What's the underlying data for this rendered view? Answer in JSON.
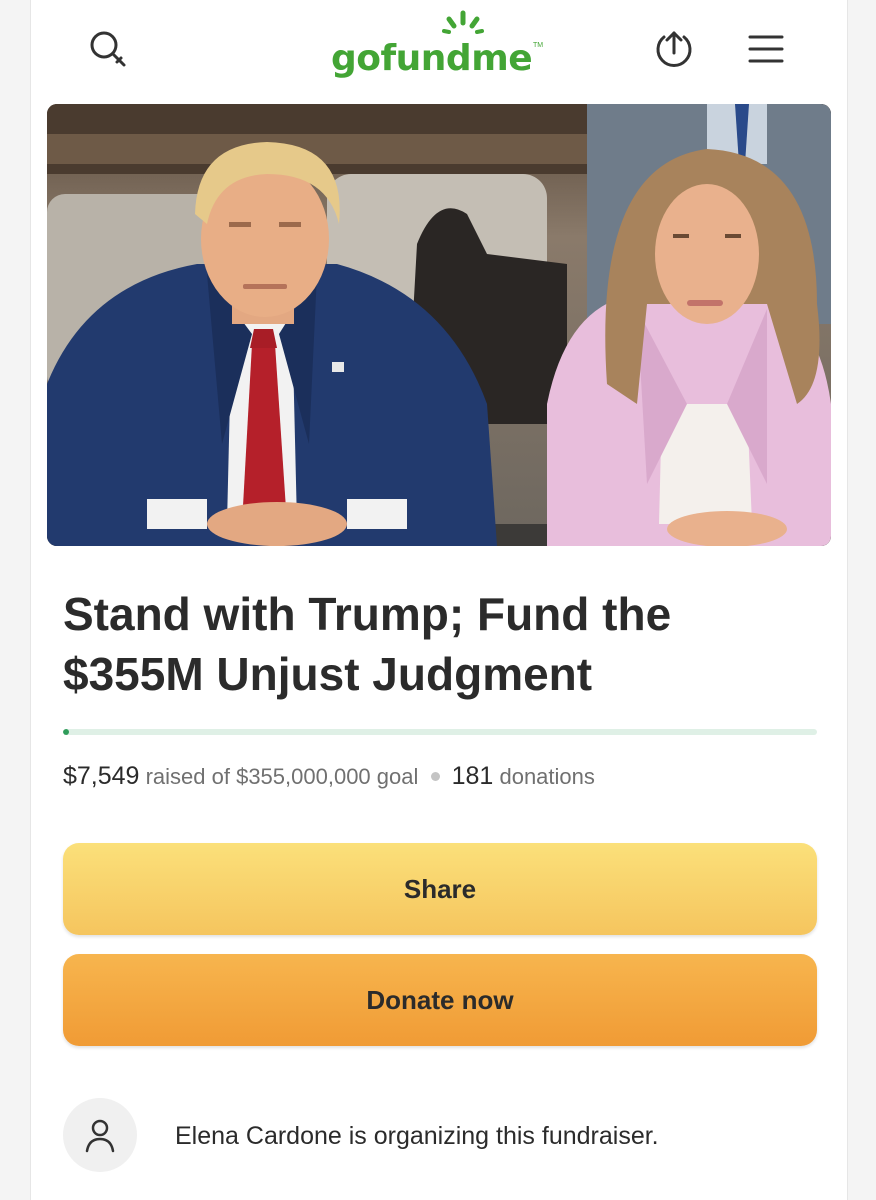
{
  "header": {
    "logo_text": "gofundme",
    "logo_tm": "TM",
    "icons": [
      "search-icon",
      "share-upload-icon",
      "hamburger-menu-icon"
    ]
  },
  "campaign": {
    "title_line1": "Stand with Trump; Fund the",
    "title_line2": "$355M Unjust Judgment",
    "raised_amount": "$7,549",
    "raised_label": "raised of $355,000,000 goal",
    "donation_count": "181",
    "donations_label": "donations",
    "progress_fraction": 2.13e-05
  },
  "buttons": {
    "share_label": "Share",
    "donate_label": "Donate now"
  },
  "organizer": {
    "text": "Elena Cardone is organizing this fundraiser.",
    "avatar_icon": "user-icon"
  },
  "colors": {
    "brand_green": "#43a535",
    "progress_green": "#2f9c5a",
    "share_button": "#f8d36c",
    "donate_button": "#f3a640"
  }
}
